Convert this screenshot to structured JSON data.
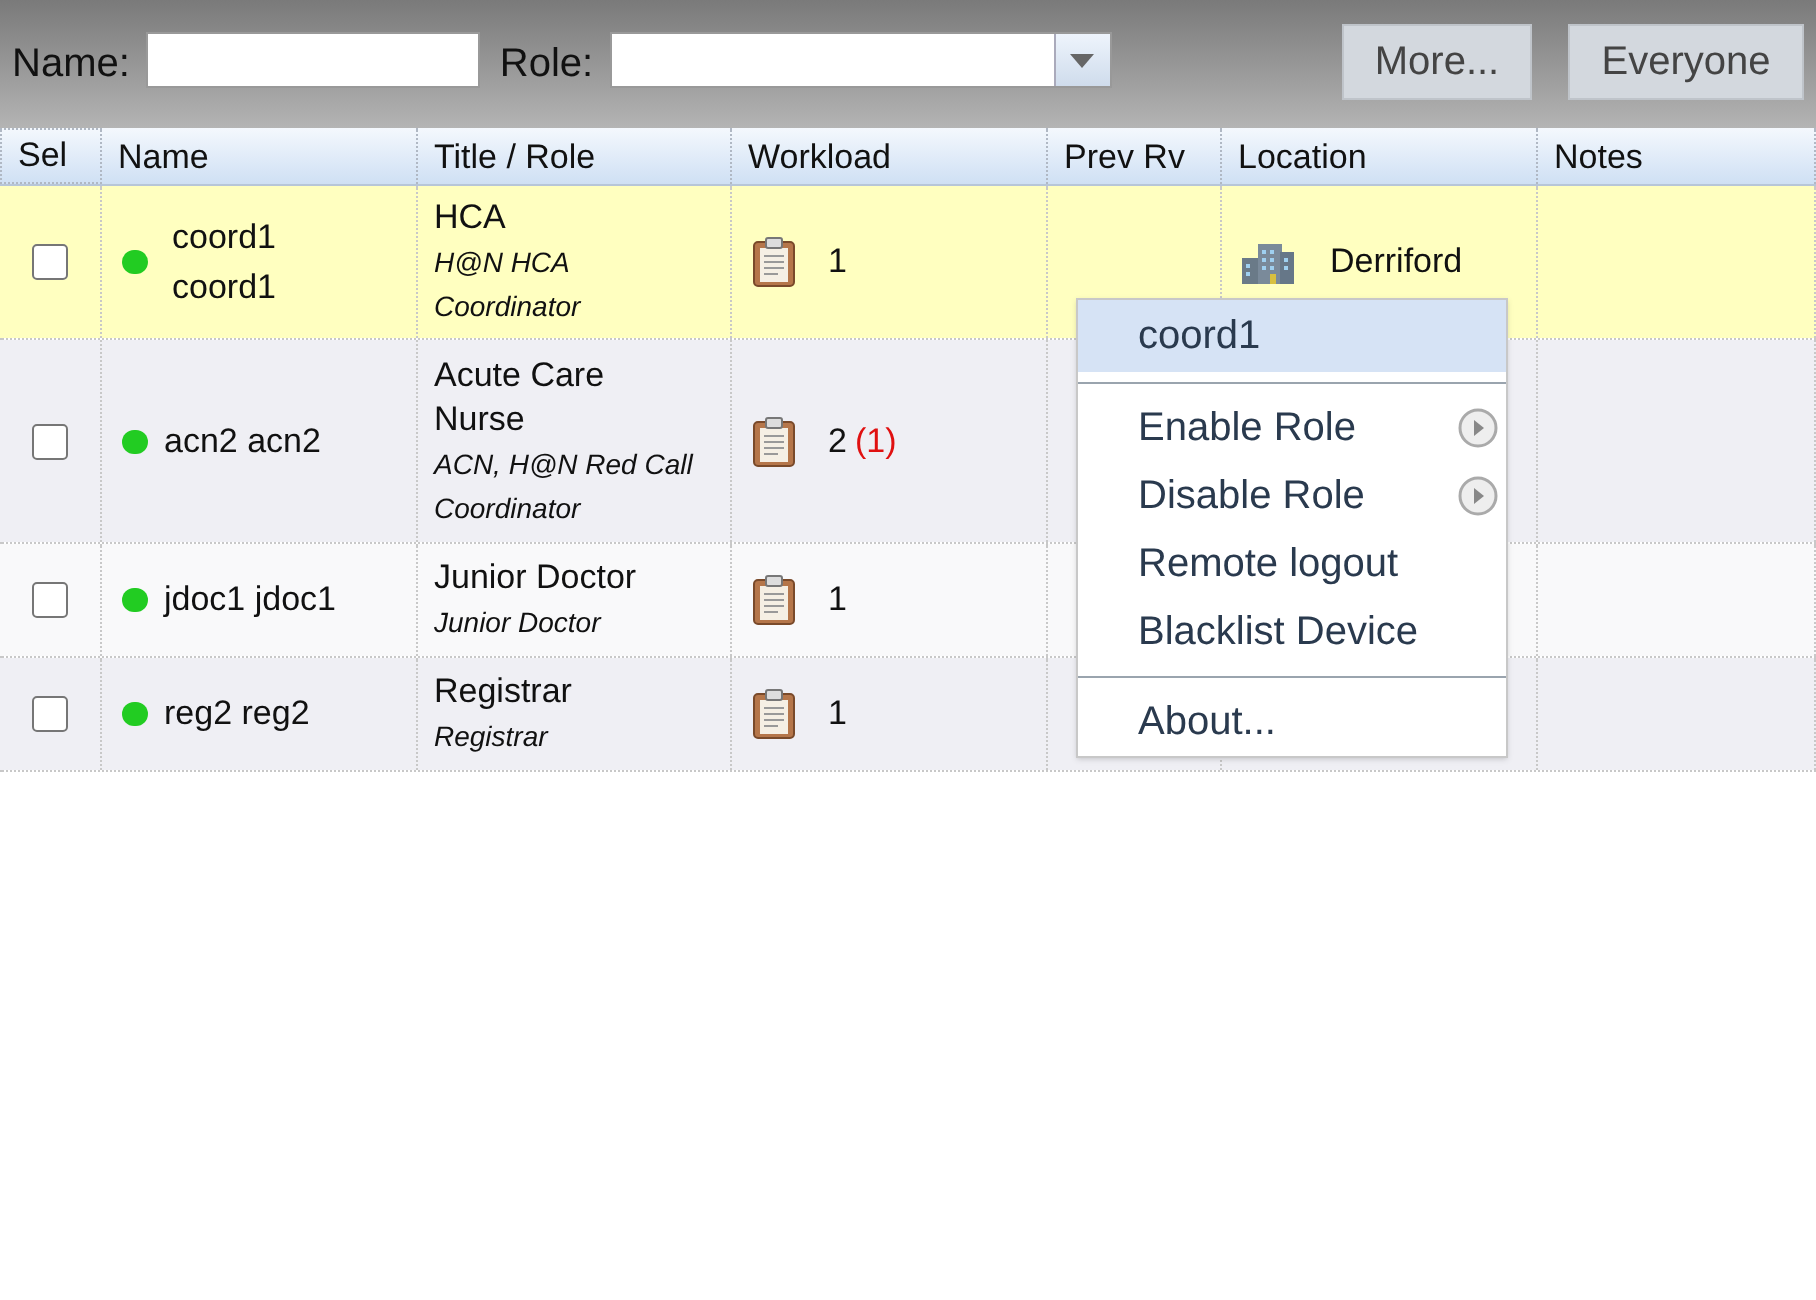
{
  "filters": {
    "name_label": "Name:",
    "role_label": "Role:",
    "buttons": [
      "More...",
      "Everyone"
    ]
  },
  "table": {
    "columns": [
      "Sel",
      "Name",
      "Title / Role",
      "Workload",
      "Prev Rv",
      "Location",
      "Notes"
    ],
    "rows": [
      {
        "selected": true,
        "checked": false,
        "color": "#22cc22",
        "name": "coord1 coord1",
        "title": "HCA",
        "roles": "H@N HCA Coordinator",
        "workload": "1",
        "location": "Derriford"
      },
      {
        "selected": false,
        "checked": false,
        "color": "#22cc22",
        "name": "acn2 acn2",
        "title": "Acute Care Nurse",
        "roles": "ACN, H@N Red Call Coordinator",
        "workload": "2",
        "workload_extra": "(1)"
      },
      {
        "selected": false,
        "checked": false,
        "color": "#22cc22",
        "name": "jdoc1 jdoc1",
        "title": "Junior Doctor",
        "roles": "Junior Doctor",
        "workload": "1"
      },
      {
        "selected": false,
        "checked": false,
        "color": "#22cc22",
        "name": "reg2 reg2",
        "title": "Registrar",
        "roles": "Registrar",
        "workload": "1"
      }
    ]
  },
  "context_menu": [
    {
      "kind": "header",
      "label": "coord1",
      "selected": true
    },
    {
      "kind": "separator"
    },
    {
      "kind": "item",
      "label": "Enable Role",
      "submenu": true,
      "selected": false
    },
    {
      "kind": "item",
      "label": "Disable Role",
      "submenu": true,
      "selected": false
    },
    {
      "kind": "item",
      "label": "Remote logout",
      "submenu": false,
      "selected": false
    },
    {
      "kind": "item",
      "label": "Blacklist Device",
      "submenu": false,
      "selected": false
    },
    {
      "kind": "separator"
    },
    {
      "kind": "item",
      "label": "About...",
      "submenu": false,
      "selected": false
    }
  ]
}
